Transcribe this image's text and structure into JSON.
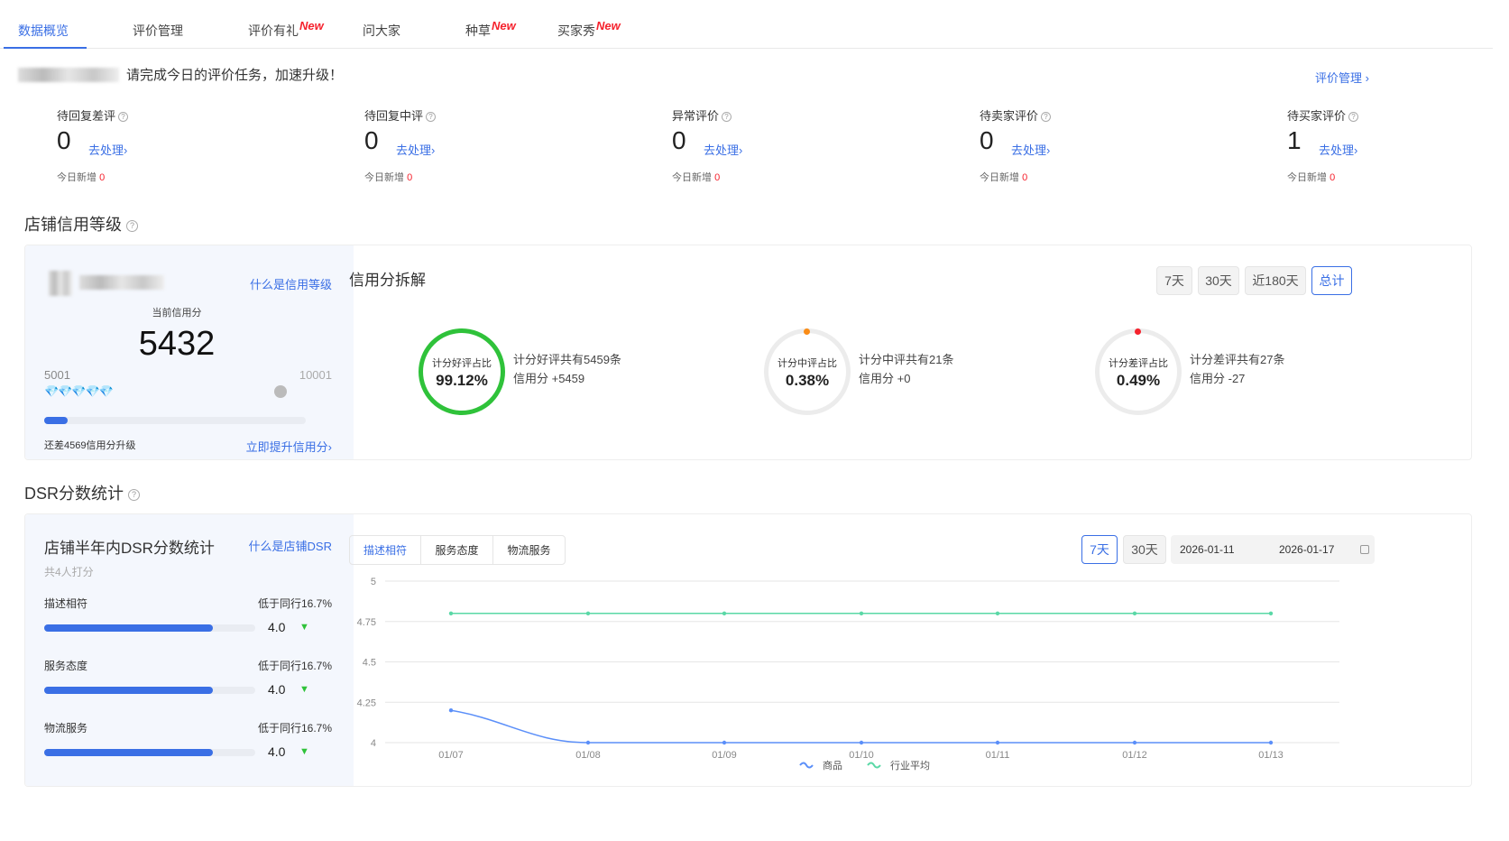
{
  "tabs": [
    {
      "label": "数据概览",
      "new": ""
    },
    {
      "label": "评价管理",
      "new": ""
    },
    {
      "label": "评价有礼",
      "new": "New"
    },
    {
      "label": "问大家",
      "new": ""
    },
    {
      "label": "种草",
      "new": "New"
    },
    {
      "label": "买家秀",
      "new": "New"
    }
  ],
  "notice": "请完成今日的评价任务，加速升级！",
  "top_link": "评价管理 ›",
  "stats": [
    {
      "label": "待回复差评",
      "value": "0",
      "action": "去处理›",
      "today_label": "今日新增",
      "today_value": "0"
    },
    {
      "label": "待回复中评",
      "value": "0",
      "action": "去处理›",
      "today_label": "今日新增",
      "today_value": "0"
    },
    {
      "label": "异常评价",
      "value": "0",
      "action": "去处理›",
      "today_label": "今日新增",
      "today_value": "0"
    },
    {
      "label": "待卖家评价",
      "value": "0",
      "action": "去处理›",
      "today_label": "今日新增",
      "today_value": "0"
    },
    {
      "label": "待买家评价",
      "value": "1",
      "action": "去处理›",
      "today_label": "今日新增",
      "today_value": "0"
    }
  ],
  "credit": {
    "section_title": "店铺信用等级",
    "what_link": "什么是信用等级",
    "current_label": "当前信用分",
    "score": "5432",
    "min": "5001",
    "max": "10001",
    "progress": 0.09,
    "remain_text": "还差4569信用分升级",
    "upgrade_link": "立即提升信用分›",
    "breakdown_title": "信用分拆解",
    "ranges": [
      "7天",
      "30天",
      "近180天",
      "总计"
    ],
    "active_range": "总计",
    "rings": [
      {
        "label": "计分好评占比",
        "value": "99.12%",
        "line1": "计分好评共有5459条",
        "line2": "信用分 +5459",
        "color": "#2fc23a"
      },
      {
        "label": "计分中评占比",
        "value": "0.38%",
        "line1": "计分中评共有21条",
        "line2": "信用分 +0",
        "color": "#fa8c16"
      },
      {
        "label": "计分差评占比",
        "value": "0.49%",
        "line1": "计分差评共有27条",
        "line2": "信用分 -27",
        "color": "#f5222d"
      }
    ]
  },
  "dsr": {
    "section_title": "DSR分数统计",
    "panel_title": "店铺半年内DSR分数统计",
    "what_link": "什么是店铺DSR",
    "raters": "共4人打分",
    "rows": [
      {
        "name": "描述相符",
        "compare": "低于同行16.7%",
        "score": "4.0"
      },
      {
        "name": "服务态度",
        "compare": "低于同行16.7%",
        "score": "4.0"
      },
      {
        "name": "物流服务",
        "compare": "低于同行16.7%",
        "score": "4.0"
      }
    ],
    "chart_tabs": [
      "描述相符",
      "服务态度",
      "物流服务"
    ],
    "active_chart_tab": "描述相符",
    "ranges": [
      "7天",
      "30天"
    ],
    "active_range": "7天",
    "date_start": "2026-01-11",
    "date_end": "2026-01-17"
  },
  "chart_data": {
    "type": "line",
    "x": [
      "01/07",
      "01/08",
      "01/09",
      "01/10",
      "01/11",
      "01/12",
      "01/13"
    ],
    "series": [
      {
        "name": "商品",
        "values": [
          4.2,
          4.0,
          4.0,
          4.0,
          4.0,
          4.0,
          4.0
        ],
        "color": "#5b8ff9"
      },
      {
        "name": "行业平均",
        "values": [
          4.8,
          4.8,
          4.8,
          4.8,
          4.8,
          4.8,
          4.8
        ],
        "color": "#5ad8a6"
      }
    ],
    "ylim": [
      4,
      5
    ],
    "yticks": [
      "5",
      "4.75",
      "4.5",
      "4.25",
      "4"
    ]
  }
}
